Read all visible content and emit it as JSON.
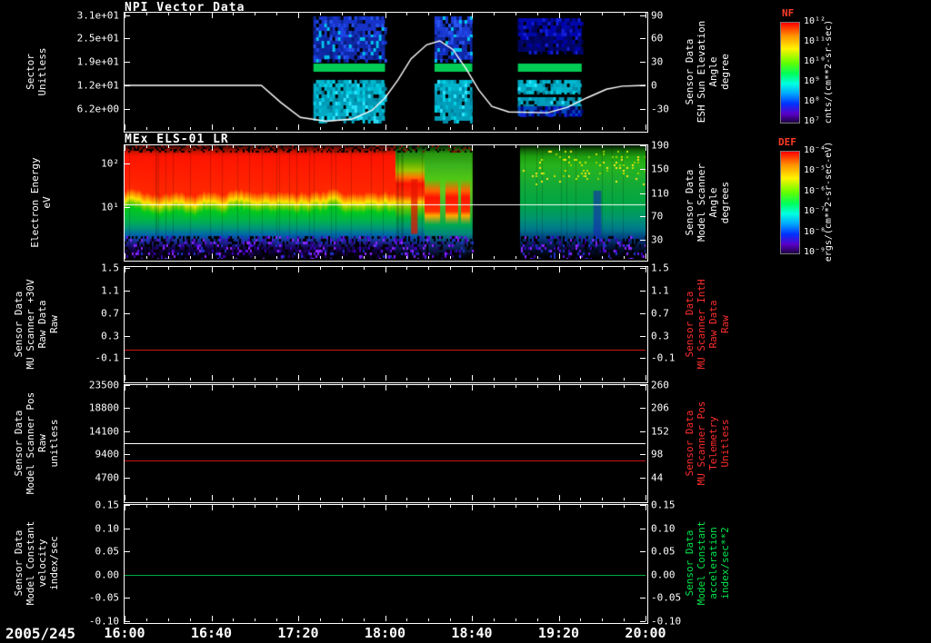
{
  "x_axis": {
    "date_label": "2005/245",
    "tick_labels": [
      "16:00",
      "16:40",
      "17:20",
      "18:00",
      "18:40",
      "19:20",
      "20:00"
    ]
  },
  "panels": [
    {
      "title": "NPI Vector Data",
      "left_label_lines": [
        "Sector",
        "Unitless"
      ],
      "left_ticks": [
        "3.1e+01",
        "2.5e+01",
        "1.9e+01",
        "1.2e+01",
        "6.2e+00"
      ],
      "right_ticks": [
        "90",
        "60",
        "30",
        "0",
        "-30"
      ],
      "right_label_lines": [
        "Sensor Data",
        "ESH Sun Elevation",
        "Angle",
        "degree"
      ],
      "right_label_color": "#ffffff"
    },
    {
      "title": "MEx ELS-01 LR",
      "left_label_lines": [
        "Electron Energy",
        "eV"
      ],
      "left_ticks": [
        "10²",
        "10¹"
      ],
      "right_ticks": [
        "190",
        "150",
        "110",
        "70",
        "30"
      ],
      "right_label_lines": [
        "Sensor Data",
        "Model Scanner",
        "Angle",
        "degrees"
      ],
      "right_label_color": "#ffffff"
    },
    {
      "title": "",
      "left_label_lines": [
        "Sensor Data",
        "MU Scanner +30V",
        "Raw Data",
        "Raw"
      ],
      "left_ticks": [
        "1.5",
        "1.1",
        "0.7",
        "0.3",
        "-0.1"
      ],
      "right_ticks": [
        "1.5",
        "1.1",
        "0.7",
        "0.3",
        "-0.1"
      ],
      "right_label_lines": [
        "Sensor Data",
        "MU Scanner IntH",
        "Raw Data",
        "Raw"
      ],
      "right_label_color": "#ff2d2d"
    },
    {
      "title": "",
      "left_label_lines": [
        "Sensor Data",
        "Model Scanner Pos",
        "Raw",
        "unitless"
      ],
      "left_ticks": [
        "23500",
        "18800",
        "14100",
        "9400",
        "4700"
      ],
      "right_ticks": [
        "260",
        "206",
        "152",
        "98",
        "44"
      ],
      "right_label_lines": [
        "Sensor Data",
        "MU Scanner Pos",
        "Telemetry",
        "Unitless"
      ],
      "right_label_color": "#ff2d2d"
    },
    {
      "title": "",
      "left_label_lines": [
        "Sensor Data",
        "Model Constant",
        "velocity",
        "index/sec"
      ],
      "left_ticks": [
        "0.15",
        "0.10",
        "0.05",
        "0.00",
        "-0.05",
        "-0.10"
      ],
      "right_ticks": [
        "0.15",
        "0.10",
        "0.05",
        "0.00",
        "-0.05",
        "-0.10"
      ],
      "right_label_lines": [
        "Sensor Data",
        "Model Constant",
        "acceleration",
        "index/sec**2"
      ],
      "right_label_color": "#00e64b"
    }
  ],
  "colorbars": [
    {
      "name": "NF",
      "name_color": "#ff3c28",
      "ticks": [
        "10¹²",
        "10¹¹",
        "10¹⁰",
        "10⁹",
        "10⁸",
        "10⁷"
      ],
      "unit": "cnts/(cm**2-sr-sec)"
    },
    {
      "name": "DEF",
      "name_color": "#ff3c28",
      "ticks": [
        "10⁻⁴",
        "10⁻⁵",
        "10⁻⁶",
        "10⁻⁷",
        "10⁻⁸",
        "10⁻⁹"
      ],
      "unit": "ergs/(cm**2-sr-sec-eV)"
    }
  ],
  "chart_data": [
    {
      "type": "heatmap",
      "title": "NPI Vector Data",
      "xlim_hours": [
        16,
        20
      ],
      "x_tick_hours": [
        16,
        16.667,
        17.333,
        18,
        18.667,
        19.333,
        20
      ],
      "ylabel": "Sector (Unitless)",
      "yticks": [
        31,
        25,
        19,
        12,
        6.2
      ],
      "right_axis": {
        "label": "ESH Sun Elevation Angle (degree)",
        "ticks": [
          90,
          60,
          30,
          0,
          -30
        ]
      },
      "line_series": {
        "name": "ESH Sun Elevation Angle",
        "color": "#ffffff",
        "points_hour_deg": [
          [
            16,
            0
          ],
          [
            17.05,
            0
          ],
          [
            17.2,
            -22
          ],
          [
            17.35,
            -41
          ],
          [
            17.55,
            -46
          ],
          [
            17.75,
            -43
          ],
          [
            17.9,
            -32
          ],
          [
            18.0,
            -16
          ],
          [
            18.1,
            7
          ],
          [
            18.2,
            34
          ],
          [
            18.32,
            52
          ],
          [
            18.42,
            57
          ],
          [
            18.52,
            46
          ],
          [
            18.62,
            22
          ],
          [
            18.72,
            -6
          ],
          [
            18.82,
            -27
          ],
          [
            18.95,
            -34
          ],
          [
            19.25,
            -35
          ],
          [
            19.4,
            -28
          ],
          [
            19.55,
            -16
          ],
          [
            19.7,
            -5
          ],
          [
            19.82,
            -1
          ],
          [
            20,
            0
          ]
        ]
      },
      "heat_blocks": [
        {
          "t0": 17.45,
          "t1": 18.0,
          "stripes": [
            {
              "f0": 0.03,
              "f1": 0.21,
              "color": "#1733c8",
              "speckle": "blue"
            },
            {
              "f0": 0.21,
              "f1": 0.4,
              "color": "#1028a8",
              "speckle": "blue"
            },
            {
              "f0": 0.435,
              "f1": 0.505,
              "color": "#00cc55",
              "speckle": "none"
            },
            {
              "f0": 0.575,
              "f1": 0.7,
              "color": "#00b4cc",
              "speckle": "cyan"
            },
            {
              "f0": 0.7,
              "f1": 0.79,
              "color": "#0098b4",
              "speckle": "cyan"
            },
            {
              "f0": 0.79,
              "f1": 0.925,
              "color": "#00a8c4",
              "speckle": "cyan"
            }
          ]
        },
        {
          "t0": 18.38,
          "t1": 18.67,
          "stripes": [
            {
              "f0": 0.03,
              "f1": 0.21,
              "color": "#1c3ad2",
              "speckle": "blue"
            },
            {
              "f0": 0.21,
              "f1": 0.4,
              "color": "#1028a8",
              "speckle": "blue"
            },
            {
              "f0": 0.435,
              "f1": 0.505,
              "color": "#00cc55",
              "speckle": "none"
            },
            {
              "f0": 0.575,
              "f1": 0.7,
              "color": "#00b4cc",
              "speckle": "cyan"
            },
            {
              "f0": 0.7,
              "f1": 0.925,
              "color": "#009cb8",
              "speckle": "cyan"
            }
          ]
        },
        {
          "t0": 19.02,
          "t1": 19.51,
          "stripes": [
            {
              "f0": 0.05,
              "f1": 0.2,
              "color": "#0008a8",
              "speckle": "navy"
            },
            {
              "f0": 0.2,
              "f1": 0.33,
              "color": "#000668",
              "speckle": "navy"
            },
            {
              "f0": 0.435,
              "f1": 0.505,
              "color": "#00cc55",
              "speckle": "none"
            },
            {
              "f0": 0.575,
              "f1": 0.68,
              "color": "#00b0c8",
              "speckle": "cyan"
            },
            {
              "f0": 0.72,
              "f1": 0.8,
              "color": "#0092b2",
              "speckle": "cyan"
            },
            {
              "f0": 0.8,
              "f1": 0.88,
              "color": "#0048c0",
              "speckle": "navy"
            }
          ]
        }
      ]
    },
    {
      "type": "spectrogram",
      "title": "MEx ELS-01 LR",
      "xlim_hours": [
        16,
        20
      ],
      "ylabel": "Electron Energy (eV)",
      "yscale": "log",
      "yticks": [
        100,
        10
      ],
      "right_axis": {
        "label": "Model Scanner Angle (degrees)",
        "ticks": [
          190,
          150,
          110,
          70,
          30
        ]
      },
      "colorbar": {
        "name": "DEF",
        "unit": "ergs/(cm**2-sr-sec-eV)"
      },
      "white_line_frac": 0.52,
      "data_gap_hours": [
        18.67,
        19.03
      ],
      "regimes": [
        {
          "t0": 16.0,
          "t1": 18.08,
          "profile": "intense-red-band"
        },
        {
          "t0": 18.08,
          "t1": 18.3,
          "profile": "narrowing-red"
        },
        {
          "t0": 18.3,
          "t1": 18.67,
          "profile": "patchy-red-blobs"
        },
        {
          "t0": 19.03,
          "t1": 20.0,
          "profile": "moderate-green"
        }
      ],
      "red_blob_intervals": [
        [
          18.3,
          18.42
        ],
        [
          18.46,
          18.56
        ],
        [
          18.58,
          18.65
        ]
      ]
    },
    {
      "type": "line",
      "yticks": [
        1.5,
        1.1,
        0.7,
        0.3,
        -0.1
      ],
      "series": [
        {
          "name": "Sensor Data MU Scanner IntH Raw Data Raw",
          "color": "#cc1414",
          "constant_value": 0.06,
          "frac": 0.73
        }
      ]
    },
    {
      "type": "line",
      "yticks_left": [
        23500,
        18800,
        14100,
        9400,
        4700
      ],
      "yticks_right": [
        260,
        206,
        152,
        98,
        44
      ],
      "series": [
        {
          "name": "Sensor Data Model Scanner Pos Raw",
          "color": "#ffffff",
          "constant_value": 11700,
          "frac": 0.504
        },
        {
          "name": "Sensor Data MU Scanner Pos Telemetry",
          "color": "#cc1414",
          "constant_value": 8150,
          "frac": 0.654
        }
      ]
    },
    {
      "type": "line",
      "yticks": [
        0.15,
        0.1,
        0.05,
        0.0,
        -0.05,
        -0.1
      ],
      "series": [
        {
          "name": "Sensor Data Model Constant velocity",
          "color": "#00aa44",
          "constant_value": 0.0,
          "frac": 0.602
        }
      ]
    }
  ]
}
